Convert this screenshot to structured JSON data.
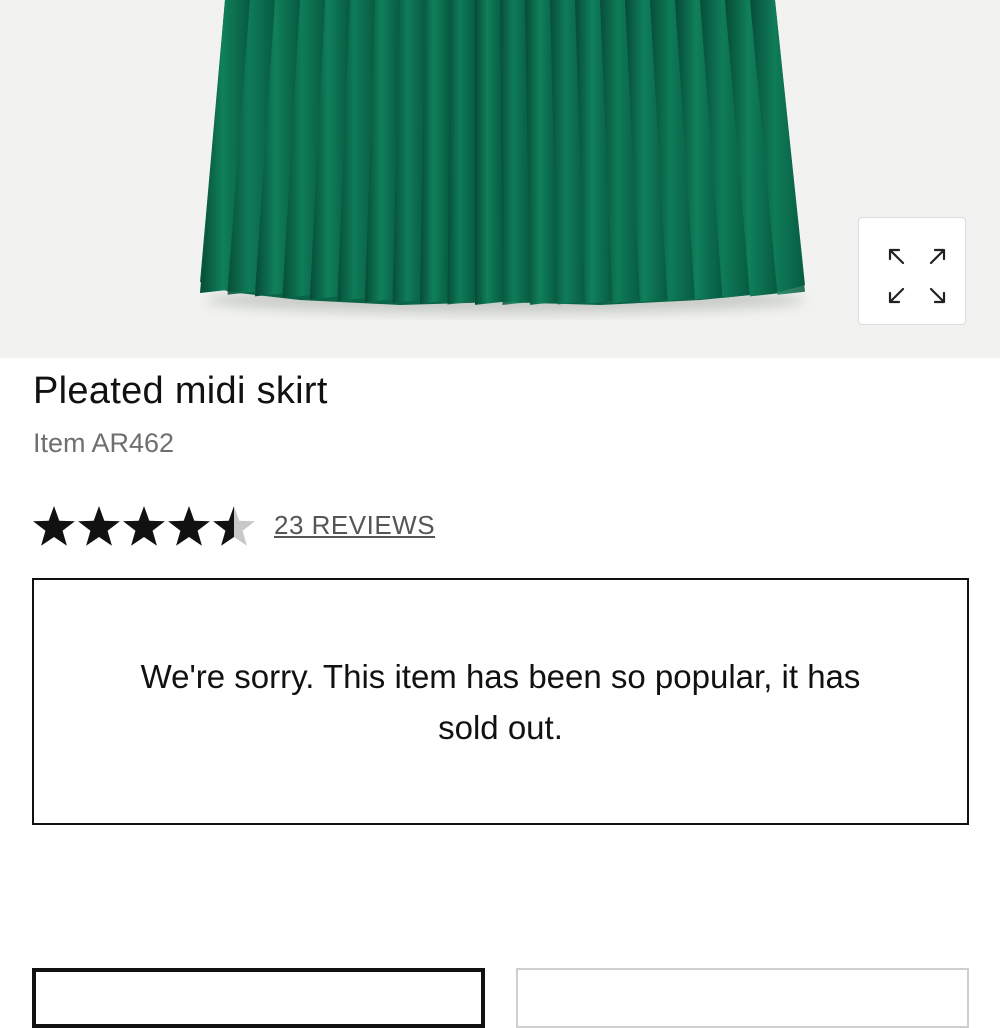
{
  "product": {
    "image_alt": "Pleated midi skirt",
    "title": "Pleated midi skirt",
    "item_code": "Item AR462",
    "rating": 4.5,
    "rating_max": 5,
    "reviews_label": "23 REVIEWS",
    "skirt_color": "#0b6b4c"
  },
  "notice": {
    "message": "We're sorry. This item has been so popular, it has sold out."
  },
  "icons": {
    "expand": "expand-icon",
    "star": "star-icon"
  }
}
